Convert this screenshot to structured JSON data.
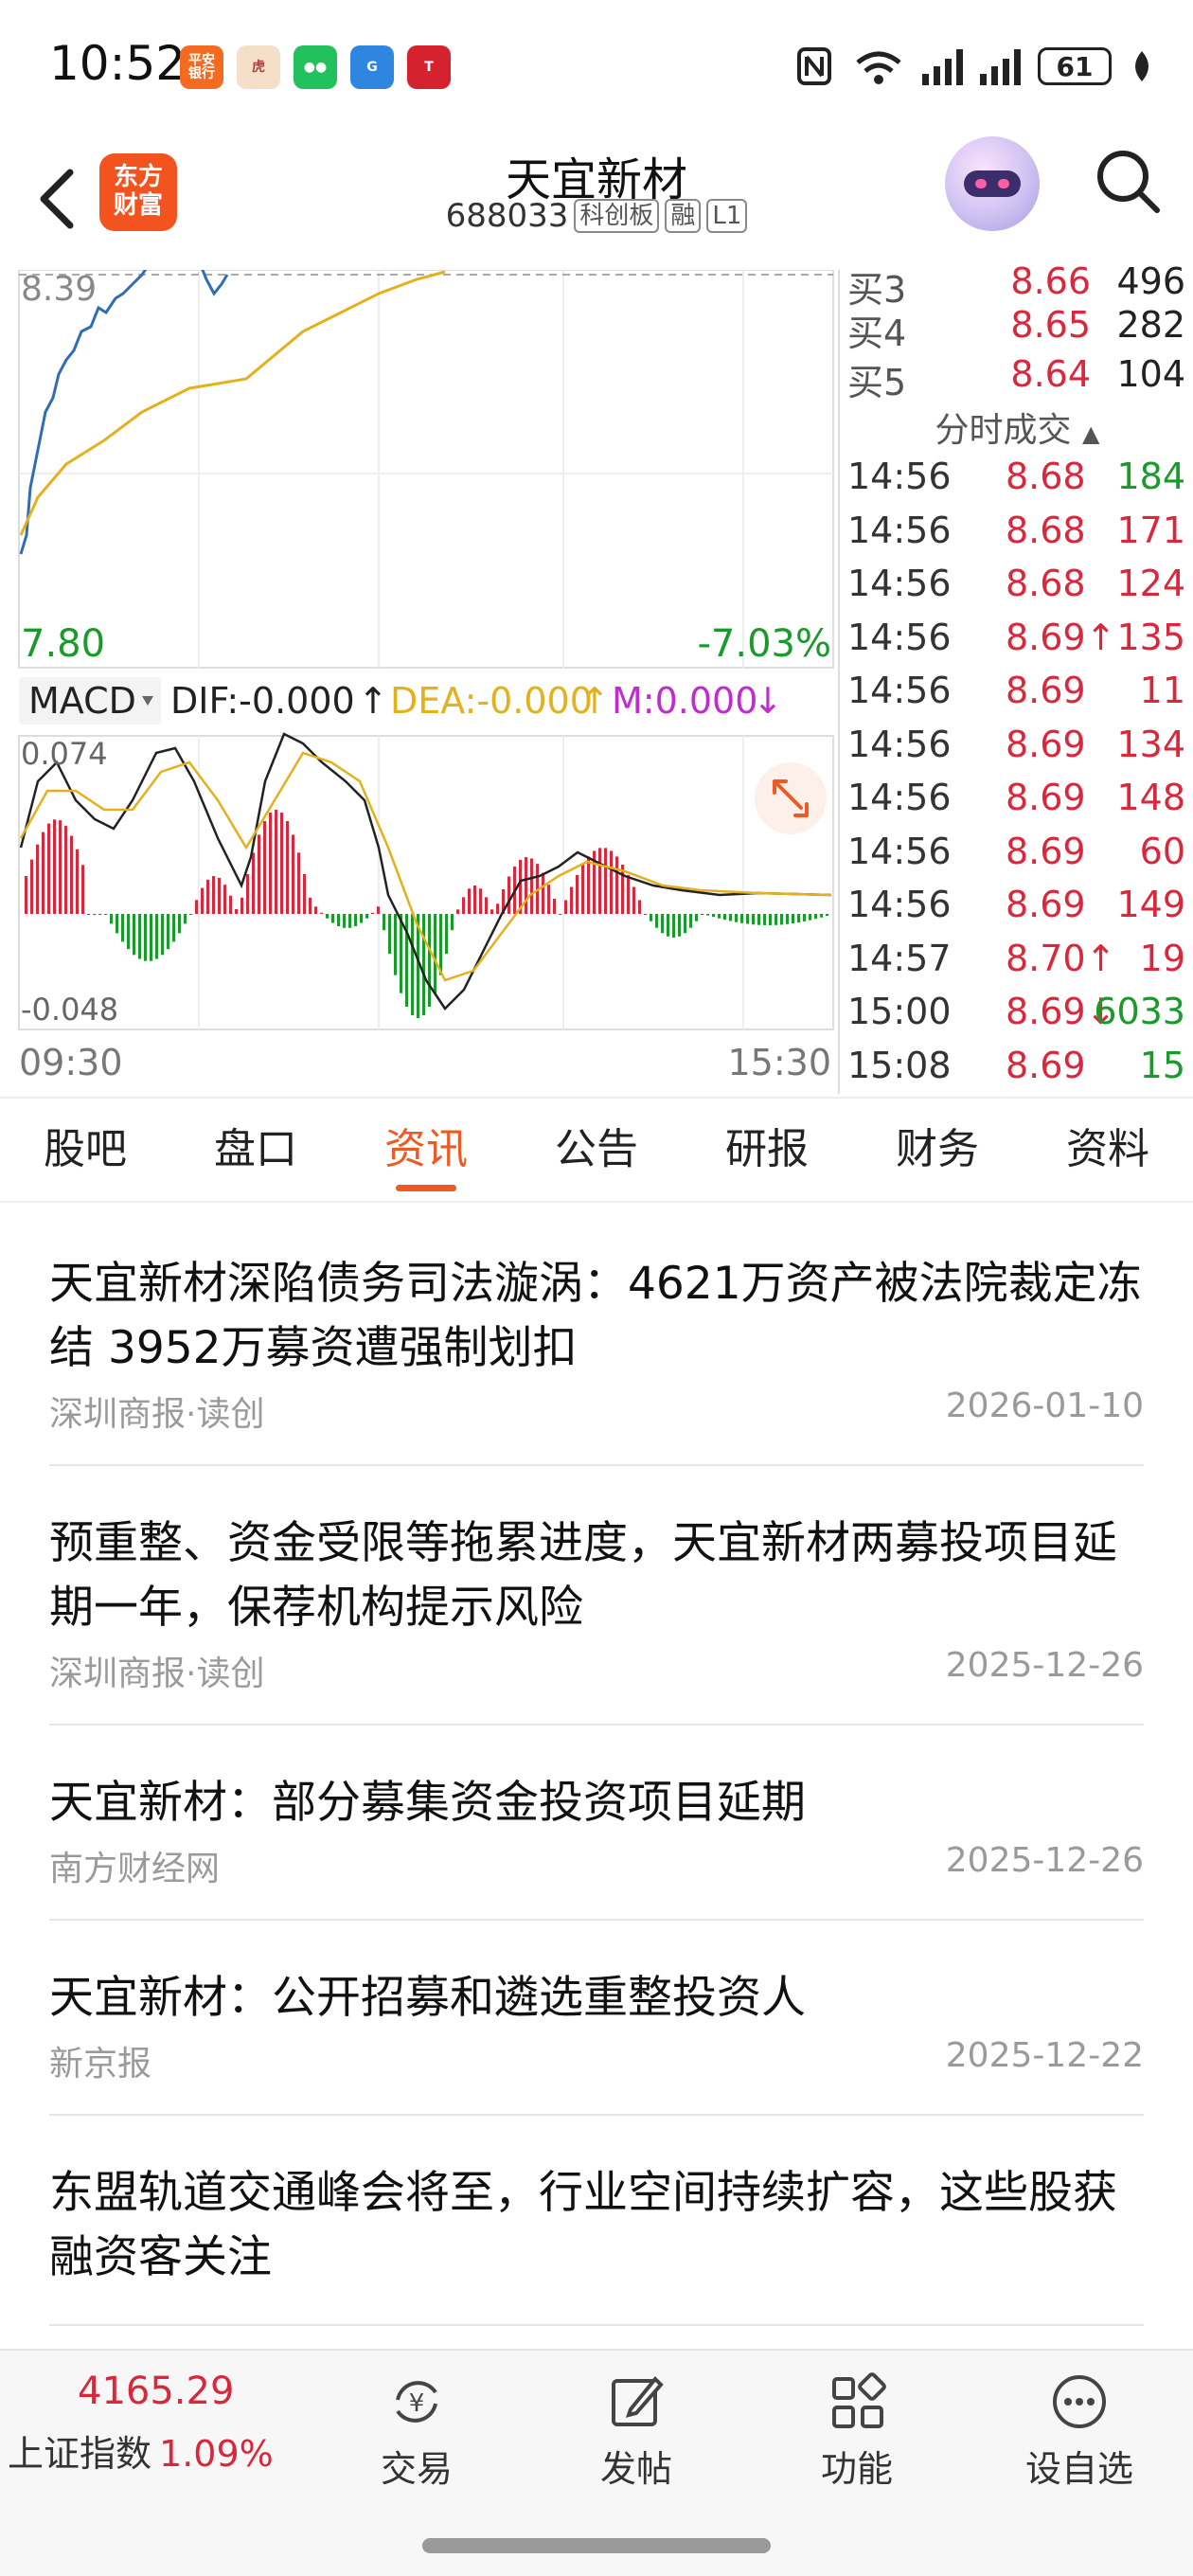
{
  "status": {
    "time": "10:52",
    "battery": "61"
  },
  "header": {
    "logo_text": "东方\n财富",
    "stock_name": "天宜新材",
    "stock_code": "688033",
    "tags": [
      "科创板",
      "融",
      "L1"
    ]
  },
  "chart": {
    "price_top": "8.39",
    "price_low": "7.80",
    "pct_low": "-7.03%",
    "indicator": "MACD",
    "dif": "DIF:-0.000",
    "dea": "DEA:-0.000",
    "m": "M:0.000",
    "macd_high": "0.074",
    "macd_low": "-0.048",
    "time_start": "09:30",
    "time_end": "15:30",
    "colors": {
      "price": "#2f6db5",
      "avg": "#e3b11c",
      "up_bar": "#d9283c",
      "down_bar": "#1b9a2c",
      "dea": "#e3b11c",
      "m": "#c02cd0"
    }
  },
  "orderbook": {
    "bids": [
      {
        "label": "买3",
        "price": "8.66",
        "vol": "496"
      },
      {
        "label": "买4",
        "price": "8.65",
        "vol": "282"
      },
      {
        "label": "买5",
        "price": "8.64",
        "vol": "104"
      }
    ],
    "ticks_title": "分时成交",
    "ticks": [
      {
        "time": "14:56",
        "price": "8.68",
        "vol": "184",
        "dir": "down"
      },
      {
        "time": "14:56",
        "price": "8.68",
        "vol": "171",
        "dir": "up"
      },
      {
        "time": "14:56",
        "price": "8.68",
        "vol": "124",
        "dir": "up"
      },
      {
        "time": "14:56",
        "price": "8.69↑",
        "vol": "135",
        "dir": "up"
      },
      {
        "time": "14:56",
        "price": "8.69",
        "vol": "11",
        "dir": "up"
      },
      {
        "time": "14:56",
        "price": "8.69",
        "vol": "134",
        "dir": "up"
      },
      {
        "time": "14:56",
        "price": "8.69",
        "vol": "148",
        "dir": "up"
      },
      {
        "time": "14:56",
        "price": "8.69",
        "vol": "60",
        "dir": "up"
      },
      {
        "time": "14:56",
        "price": "8.69",
        "vol": "149",
        "dir": "up"
      },
      {
        "time": "14:57",
        "price": "8.70↑",
        "vol": "19",
        "dir": "up"
      },
      {
        "time": "15:00",
        "price": "8.69↓",
        "vol": "6033",
        "dir": "down"
      },
      {
        "time": "15:08",
        "price": "8.69",
        "vol": "15",
        "dir": "down"
      }
    ]
  },
  "tabs": [
    "股吧",
    "盘口",
    "资讯",
    "公告",
    "研报",
    "财务",
    "资料"
  ],
  "active_tab": 2,
  "news": [
    {
      "title": "天宜新材深陷债务司法漩涡：4621万资产被法院裁定冻结 3952万募资遭强制划扣",
      "source": "深圳商报·读创",
      "date": "2026-01-10"
    },
    {
      "title": "预重整、资金受限等拖累进度，天宜新材两募投项目延期一年，保荐机构提示风险",
      "source": "深圳商报·读创",
      "date": "2025-12-26"
    },
    {
      "title": "天宜新材：部分募集资金投资项目延期",
      "source": "南方财经网",
      "date": "2025-12-26"
    },
    {
      "title": "天宜新材：公开招募和遴选重整投资人",
      "source": "新京报",
      "date": "2025-12-22"
    },
    {
      "title": "东盟轨道交通峰会将至，行业空间持续扩容，这些股获融资客关注",
      "source": "",
      "date": ""
    }
  ],
  "bottom": {
    "index_value": "4165.29",
    "index_name": "上证指数",
    "index_pct": "1.09%",
    "items": [
      {
        "label": "交易",
        "icon": "yen-exchange-icon"
      },
      {
        "label": "发帖",
        "icon": "edit-icon"
      },
      {
        "label": "功能",
        "icon": "grid-icon"
      },
      {
        "label": "设自选",
        "icon": "more-icon"
      }
    ]
  }
}
